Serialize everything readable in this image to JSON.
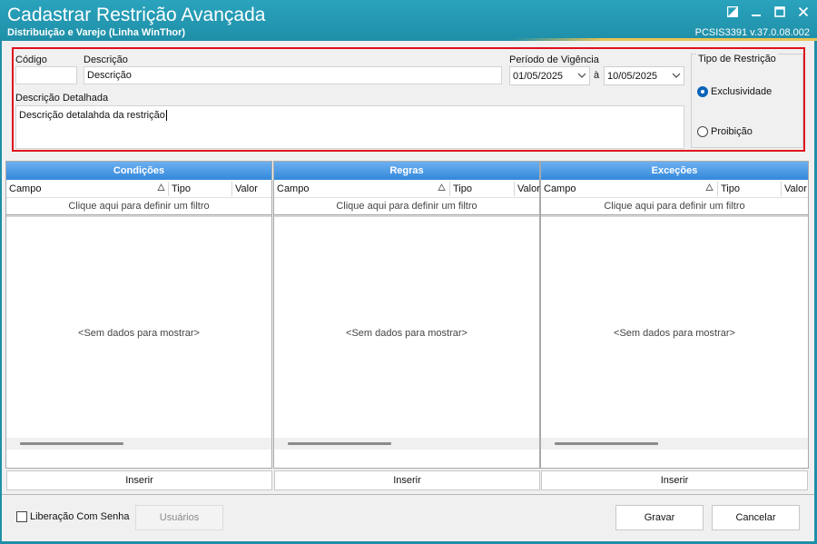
{
  "window": {
    "title": "Cadastrar Restrição Avançada",
    "subtitle": "Distribuição e Varejo (Linha WinThor)",
    "version": "PCSIS3391  v.37.0.08.002",
    "accent_color": "#1f8fa8"
  },
  "header": {
    "codigo_label": "Código",
    "codigo_value": "",
    "descricao_label": "Descrição",
    "descricao_value": "Descrição",
    "periodo_label": "Período de Vigência",
    "periodo_de": "01/05/2025",
    "periodo_sep": "à",
    "periodo_ate": "10/05/2025",
    "detalhada_label": "Descrição Detalhada",
    "detalhada_value": "Descrição detalahda da restrição",
    "tipo_label": "Tipo de Restrição",
    "tipo_options": [
      "Exclusividade",
      "Proibição"
    ],
    "tipo_selected": "Exclusividade",
    "highlight_color": "#e0101e"
  },
  "panels": [
    {
      "title": "Condições",
      "columns": [
        "Campo",
        "Tipo",
        "Valor"
      ],
      "filter_text": "Clique aqui para definir um filtro",
      "empty_text": "<Sem dados para mostrar>",
      "button": "Inserir"
    },
    {
      "title": "Regras",
      "columns": [
        "Campo",
        "Tipo",
        "Valor"
      ],
      "filter_text": "Clique aqui para definir um filtro",
      "empty_text": "<Sem dados para mostrar>",
      "button": "Inserir"
    },
    {
      "title": "Exceções",
      "columns": [
        "Campo",
        "Tipo",
        "Valor"
      ],
      "filter_text": "Clique aqui para definir um filtro",
      "empty_text": "<Sem dados para mostrar>",
      "button": "Inserir"
    }
  ],
  "footer": {
    "liberacao_label": "Liberação Com Senha",
    "usuarios_label": "Usuários",
    "gravar_label": "Gravar",
    "cancelar_label": "Cancelar"
  }
}
